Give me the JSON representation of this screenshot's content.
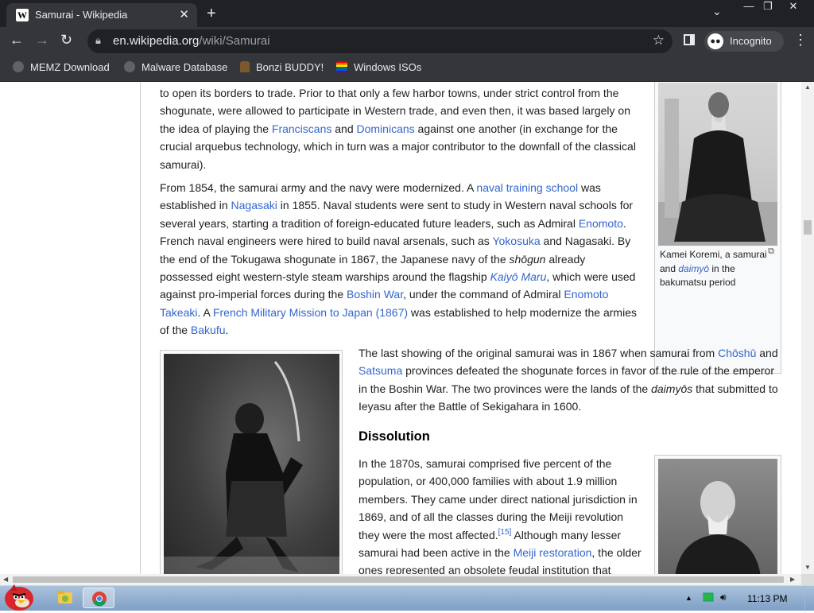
{
  "browser": {
    "tab_title": "Samurai - Wikipedia",
    "tab_favicon": "W",
    "url_domain": "en.wikipedia.org",
    "url_path": "/wiki/Samurai",
    "profile_label": "Incognito",
    "bookmarks": [
      "MEMZ Download",
      "Malware Database",
      "Bonzi BUDDY!",
      "Windows ISOs"
    ]
  },
  "article": {
    "p1": {
      "t1": "to open its borders to trade. Prior to that only a few harbor towns, under strict control from the shogunate, were allowed to participate in Western trade, and even then, it was based largely on the idea of playing the ",
      "l1": "Franciscans",
      "t2": " and ",
      "l2": "Dominicans",
      "t3": " against one another (in exchange for the crucial arquebus technology, which in turn was a major contributor to the downfall of the classical samurai)."
    },
    "p2": {
      "t1": "From 1854, the samurai army and the navy were modernized. A ",
      "l1": "naval training school",
      "t2": " was established in ",
      "l2": "Nagasaki",
      "t3": " in 1855. Naval students were sent to study in Western naval schools for several years, starting a tradition of foreign-educated future leaders, such as Admiral ",
      "l3": "Enomoto",
      "t4": ". French naval engineers were hired to build naval arsenals, such as ",
      "l4": "Yokosuka",
      "t5": " and Nagasaki. By the end of the Tokugawa shogunate in 1867, the Japanese navy of the ",
      "i1": "shōgun",
      "t6": " already possessed eight western-style steam warships around the flagship ",
      "l5": "Kaiyō Maru",
      "t7": ", which were used against pro-imperial forces during the ",
      "l6": "Boshin War",
      "t8": ", under the command of Admiral ",
      "l7": "Enomoto Takeaki",
      "t9": ". A ",
      "l8": "French Military Mission to Japan (1867)",
      "t10": " was established to help modernize the armies of the ",
      "l9": "Bakufu",
      "t11": "."
    },
    "p3": {
      "t1": "The last showing of the original samurai was in 1867 when samurai from ",
      "l1": "Chōshū",
      "t2": " and ",
      "l2": "Satsuma",
      "t3": " provinces defeated the shogunate forces in favor of the rule of the emperor in the Boshin War. The two provinces were the lands of the ",
      "i1": "daimyōs",
      "t4": " that submitted to Ieyasu after the Battle of Sekigahara in 1600."
    },
    "heading_dissolution": "Dissolution",
    "p4": {
      "t1": "In the 1870s, samurai comprised five percent of the population, or 400,000 families with about 1.9 million members. They came under direct national jurisdiction in 1869, and of all the classes during the Meiji revolution they were the most affected.",
      "ref": "[15]",
      "t2": " Although many lesser samurai had been active in the ",
      "l1": "Meiji restoration",
      "t3": ", the older ones represented an obsolete feudal institution that"
    },
    "caption_koremi": {
      "t1": "Kamei Koremi, a samurai and ",
      "l1": "daimyō",
      "t2": " in the bakumatsu period"
    }
  },
  "taskbar": {
    "clock": "11:13 PM"
  },
  "colors": {
    "link": "#3366cc",
    "chrome_dark": "#202124",
    "chrome_toolbar": "#35363a"
  }
}
